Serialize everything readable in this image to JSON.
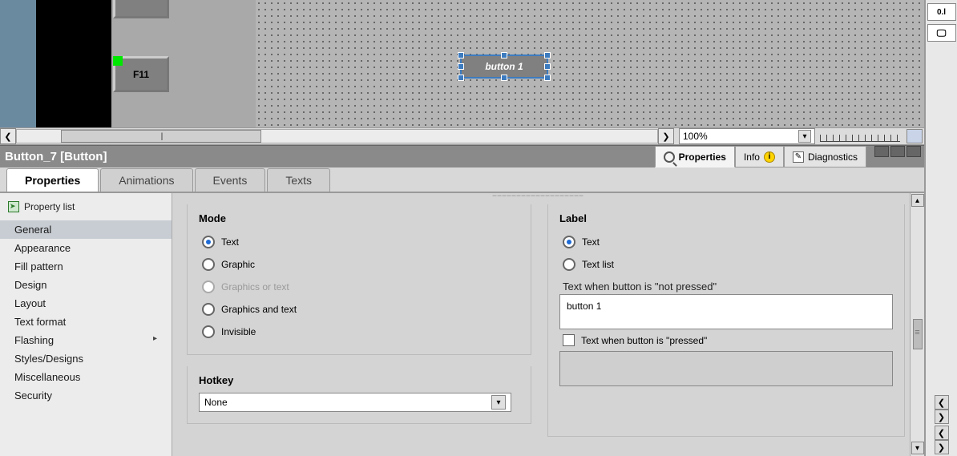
{
  "canvas": {
    "keys": {
      "f11": "F11"
    },
    "placed_button_text": "button 1"
  },
  "hbar": {
    "zoom": "100%"
  },
  "object_bar": {
    "title": "Button_7 [Button]"
  },
  "info_tabs": {
    "properties": "Properties",
    "info": "Info",
    "diagnostics": "Diagnostics"
  },
  "subtabs": {
    "properties": "Properties",
    "animations": "Animations",
    "events": "Events",
    "texts": "Texts"
  },
  "prop_nav": {
    "header": "Property list",
    "items": [
      "General",
      "Appearance",
      "Fill pattern",
      "Design",
      "Layout",
      "Text format",
      "Flashing",
      "Styles/Designs",
      "Miscellaneous",
      "Security"
    ]
  },
  "mode_group": {
    "title": "Mode",
    "options": {
      "text": "Text",
      "graphic": "Graphic",
      "graphics_or_text": "Graphics or text",
      "graphics_and_text": "Graphics and text",
      "invisible": "Invisible"
    }
  },
  "hotkey_group": {
    "title": "Hotkey",
    "value": "None"
  },
  "label_group": {
    "title": "Label",
    "option_text": "Text",
    "option_textlist": "Text list",
    "not_pressed_label": "Text when button is \"not pressed\"",
    "not_pressed_value": "button 1",
    "pressed_label": "Text when button is \"pressed\""
  },
  "sidebar_right": {
    "btn1": "0.l"
  }
}
